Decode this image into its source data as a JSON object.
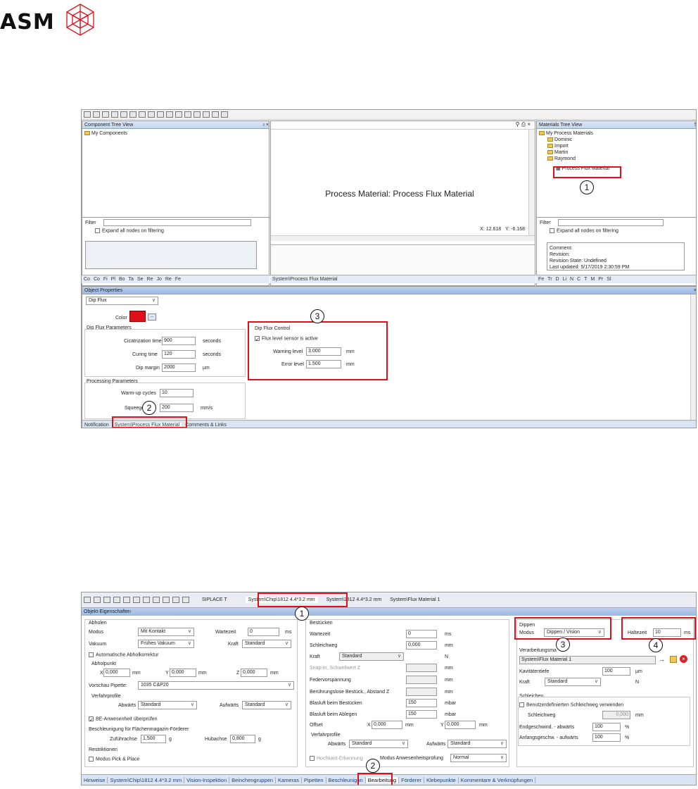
{
  "logo": {
    "text": "ASM",
    "color": "#e0101a"
  },
  "accent_red": "#e0101a",
  "screenshot1": {
    "component_tree": {
      "title": "Component Tree View",
      "pin": "ı ×",
      "root": "My Components"
    },
    "component_filter": {
      "label": "Filter",
      "expand": "Expand all nodes on filtering"
    },
    "component_tabs": [
      "Co",
      "Co",
      "Fi",
      "Pl",
      "Bo",
      "Ta",
      "Se",
      "Re",
      "Jo",
      "Re",
      "Fe"
    ],
    "center": {
      "title": "Process Material: Process Flux Material",
      "x": "X: 12.618",
      "y": "Y: -6.168",
      "tab": "System\\Process Flux Material"
    },
    "materials_tree": {
      "title": "Materials Tree View",
      "root": "My Process Materials",
      "children": [
        "Dominic",
        "Import",
        "Martin",
        "Raymond"
      ],
      "selected": "Process Flux Material"
    },
    "materials_filter": {
      "label": "Filter",
      "expand": "Expand all nodes on filtering"
    },
    "materials_info": [
      "Comment:",
      "Revision:",
      "Revision State: Undefined",
      "Last updated: 5/17/2019 2:30:59 PM"
    ],
    "materials_tabs": [
      "Fe",
      "Tr",
      "D",
      "Li",
      "N",
      "C",
      "T",
      "M",
      "Pr",
      "Sl"
    ],
    "object_props": {
      "title": "Object Properties",
      "type": "Dip Flux",
      "color_label": "Color",
      "dip_params": "Dip Flux Parameters",
      "cic_label": "Cicatrization time",
      "cic_value": "900",
      "cic_unit": "seconds",
      "curing_label": "Curing time",
      "curing_value": "120",
      "curing_unit": "seconds",
      "margin_label": "Dip margin",
      "margin_value": "2000",
      "margin_unit": "µm",
      "control": "Dip Flux Control",
      "sensor": "Flux level sensor is active",
      "warn_label": "Warning level",
      "warn_value": "3.000",
      "warn_unit": "mm",
      "err_label": "Error level",
      "err_value": "1.500",
      "err_unit": "mm",
      "proc": "Processing Parameters",
      "warm_label": "Warm-up cycles",
      "warm_value": "10",
      "squeeg_label": "Squeegee",
      "squeeg_value": "200",
      "squeeg_unit": "mm/s"
    },
    "bottom_tabs": [
      "Notification",
      "System\\Process Flux Material",
      "Comments & Links"
    ],
    "callouts": [
      "1",
      "2",
      "3"
    ]
  },
  "screenshot2": {
    "top_tabs": [
      "SIPLACE T",
      "System\\Chip\\1812 4.4*3.2 mm",
      "System\\1812 4.4*3.2 mm",
      "System\\Flux Material 1"
    ],
    "header": "Objekt-Eigenschaften",
    "abholen": {
      "title": "Abholen",
      "modus_label": "Modus",
      "modus_value": "Mit Kontakt",
      "wartezeit_label": "Wartezeit",
      "wartezeit_value": "0",
      "wartezeit_unit": "ms",
      "vakuum_label": "Vakuum",
      "vakuum_value": "Frühes Vakuum",
      "kraft_label": "Kraft",
      "kraft_value": "Standard",
      "auto": "Automatische Abholkorrektur",
      "abholpunkt": "Abholpunkt",
      "x_label": "X",
      "x_value": "0,000",
      "y_label": "Y",
      "y_value": "0,000",
      "z_label": "Z",
      "z_value": "0,000",
      "unit_mm": "mm",
      "pipette_label": "Vorschau Pipette:",
      "pipette_value": "1035 C&P20",
      "verfahr": "Verfahrprofile",
      "abw_label": "Abwärts",
      "abw_value": "Standard",
      "aufw_label": "Aufwärts",
      "aufw_value": "Standard",
      "be": "BE-Anwesenheit überprüfen",
      "beschl": "Beschleunigung für Flächenmagazin-Förderer",
      "zuf_label": "Zuführachse",
      "zuf_value": "1,500",
      "g": "g",
      "hub_label": "Hubachse",
      "hub_value": "0,800",
      "restr": "Restriktionen",
      "pick": "Modus Pick & Place"
    },
    "bestuecken": {
      "title": "Bestücken",
      "rows": [
        {
          "label": "Wartezeit",
          "value": "0",
          "unit": "ms"
        },
        {
          "label": "Schleichweg",
          "value": "0,000",
          "unit": "mm"
        },
        {
          "label": "Kraft",
          "value": "",
          "unit": "N"
        },
        {
          "label": "Snap-In, Schwellwert Z",
          "value": "",
          "unit": "mm"
        },
        {
          "label": "Federvorspannung",
          "value": "",
          "unit": "mm"
        },
        {
          "label": "Berührungslose Bestück., Abstand Z",
          "value": "",
          "unit": "mm"
        },
        {
          "label": "Blasluft beim Bestücken",
          "value": "150",
          "unit": "mbar"
        },
        {
          "label": "Blasluft beim Ablegen",
          "value": "150",
          "unit": "mbar"
        }
      ],
      "kraft_select": "Standard",
      "offset_label": "Offset",
      "ox_label": "X",
      "ox_value": "0,000",
      "oy_label": "Y",
      "oy_value": "0,000",
      "unit_mm": "mm",
      "verfahr": "Verfahrprofile",
      "abw_label": "Abwärts",
      "abw_value": "Standard",
      "aufw_label": "Aufwärts",
      "aufw_value": "Standard",
      "hochkant": "Hochkant-Erkennung",
      "modus_label": "Modus Anwesenheitsprüfung",
      "modus_value": "Normal"
    },
    "dippen": {
      "title": "Dippen",
      "modus_label": "Modus",
      "modus_value": "Dippen / Vision",
      "halte_label": "Haltezeit",
      "halte_value": "10",
      "halte_unit": "ms",
      "verarb_label": "Verarbeitungsma",
      "verarb_value": "System\\Flux Material 1",
      "kav_label": "Kavitätentiefe",
      "kav_value": "100",
      "kav_unit": "µm",
      "kraft_label": "Kraft",
      "kraft_value": "Standard",
      "kraft_unit": "N",
      "schleichen": "Schleichen",
      "benutzer": "Benutzerdefinierten Schleichweg verwenden",
      "schleichweg_label": "Schleichweg",
      "schleichweg_value": "0,000",
      "schleichweg_unit": "mm",
      "end_label": "Endgeschwind. - abwärts",
      "end_value": "100",
      "pct": "%",
      "anf_label": "Anfangsgeschw. - aufwärts",
      "anf_value": "100"
    },
    "bottom_tabs": [
      "Hinweise",
      "System\\Chip\\1812 4.4*3.2 mm",
      "Vision-Inspektion",
      "Beinchengruppen",
      "Kameras",
      "Pipetten",
      "Beschleunigun",
      "Bearbeitung",
      "Förderer",
      "Klebepunkte",
      "Kommentare & Verknüpfungen"
    ],
    "callouts": [
      "1",
      "2",
      "3",
      "4"
    ]
  }
}
